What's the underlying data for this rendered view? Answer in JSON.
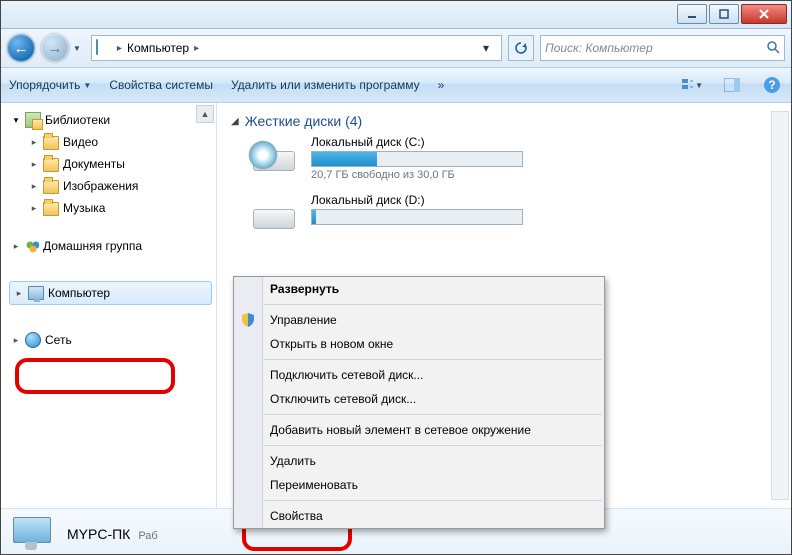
{
  "breadcrumb": {
    "root": "Компьютер"
  },
  "search": {
    "placeholder": "Поиск: Компьютер"
  },
  "toolbar": {
    "organize": "Упорядочить",
    "props": "Свойства системы",
    "uninstall": "Удалить или изменить программу",
    "overflow": "»"
  },
  "sidebar": {
    "libraries": "Библиотеки",
    "video": "Видео",
    "documents": "Документы",
    "pictures": "Изображения",
    "music": "Музыка",
    "homegroup": "Домашняя группа",
    "computer": "Компьютер",
    "network": "Сеть"
  },
  "section": {
    "title": "Жесткие диски (4)"
  },
  "drives": {
    "c": {
      "name": "Локальный диск (C:)",
      "sub": "20,7 ГБ свободно из 30,0 ГБ",
      "fill_pct": 31
    },
    "d": {
      "name": "Локальный диск (D:)",
      "fill_pct": 2
    }
  },
  "context_menu": {
    "expand": "Развернуть",
    "manage": "Управление",
    "open_new": "Открыть в новом окне",
    "map_drive": "Подключить сетевой диск...",
    "unmap_drive": "Отключить сетевой диск...",
    "add_net": "Добавить новый элемент в сетевое окружение",
    "delete": "Удалить",
    "rename": "Переименовать",
    "properties": "Свойства"
  },
  "details": {
    "name": "MYPC-ПК",
    "sub": "Раб"
  }
}
